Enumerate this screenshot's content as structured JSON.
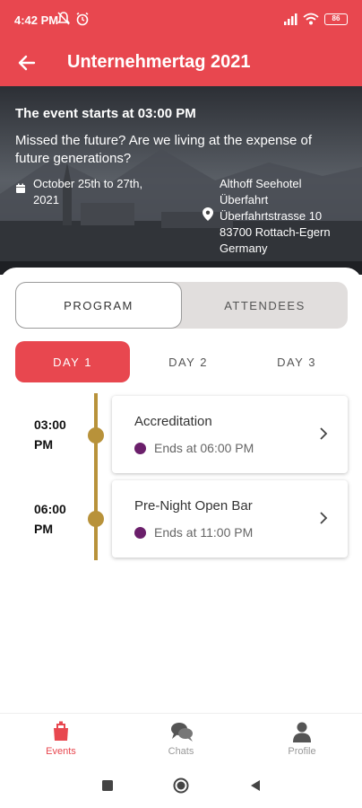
{
  "status_bar": {
    "time": "4:42 PM",
    "battery": "86"
  },
  "app_bar": {
    "title": "Unternehmertag 2021"
  },
  "hero": {
    "start_text": "The event starts at 03:00 PM",
    "description": "Missed the future? Are we living at the expense of future generations?",
    "date_lines": [
      "October 25th to 27th,",
      "2021"
    ],
    "venue_lines": [
      "Althoff Seehotel",
      "Überfahrt",
      "Überfahrtstrasse 10",
      "83700 Rottach-Egern",
      "Germany"
    ]
  },
  "segments": {
    "program": "PROGRAM",
    "attendees": "ATTENDEES",
    "selected": "program"
  },
  "day_tabs": {
    "items": [
      "DAY 1",
      "DAY 2",
      "DAY 3"
    ],
    "selected": "DAY 1"
  },
  "timeline": [
    {
      "time_lines": [
        "03:00",
        "PM"
      ],
      "title": "Accreditation",
      "ends": "Ends at 06:00 PM"
    },
    {
      "time_lines": [
        "06:00",
        "PM"
      ],
      "title": "Pre-Night Open Bar",
      "ends": "Ends at 11:00 PM"
    }
  ],
  "bottom_nav": {
    "items": [
      {
        "label": "Events",
        "icon": "events-icon",
        "active": true
      },
      {
        "label": "Chats",
        "icon": "chats-icon",
        "active": false
      },
      {
        "label": "Profile",
        "icon": "profile-icon",
        "active": false
      }
    ]
  },
  "colors": {
    "primary": "#e8474f",
    "timeline_gold": "#b8923a",
    "clock_purple": "#6b1f6b"
  }
}
